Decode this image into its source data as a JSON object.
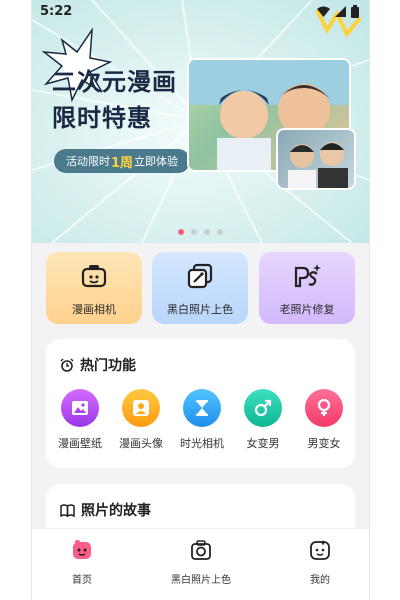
{
  "status": {
    "time": "5:22"
  },
  "banner": {
    "headline_line1": "二次元漫画",
    "headline_line2": "限时特惠",
    "promo_prefix": "活动限时",
    "promo_highlight": "1周",
    "promo_suffix": "立即体验",
    "carousel_pages": 4,
    "carousel_active": 1
  },
  "quick_actions": [
    {
      "label": "漫画相机",
      "icon": "comic-camera-icon"
    },
    {
      "label": "黑白照片上色",
      "icon": "colorize-photo-icon"
    },
    {
      "label": "老照片修复",
      "icon": "ps-restore-icon"
    }
  ],
  "hot": {
    "title": "热门功能",
    "items": [
      {
        "label": "漫画壁纸",
        "icon": "wallpaper-icon",
        "color": "#b14bf0"
      },
      {
        "label": "漫画头像",
        "icon": "avatar-icon",
        "color": "#ffb020"
      },
      {
        "label": "时光相机",
        "icon": "hourglass-icon",
        "color": "#2ea6f5"
      },
      {
        "label": "女变男",
        "icon": "male-symbol-icon",
        "color": "#1fc7a8"
      },
      {
        "label": "男变女",
        "icon": "female-symbol-icon",
        "color": "#ff4f7b"
      }
    ]
  },
  "story": {
    "title": "照片的故事"
  },
  "nav": [
    {
      "label": "首页",
      "icon": "home-icon"
    },
    {
      "label": "黑白照片上色",
      "icon": "camera-icon"
    },
    {
      "label": "我的",
      "icon": "profile-icon"
    }
  ]
}
